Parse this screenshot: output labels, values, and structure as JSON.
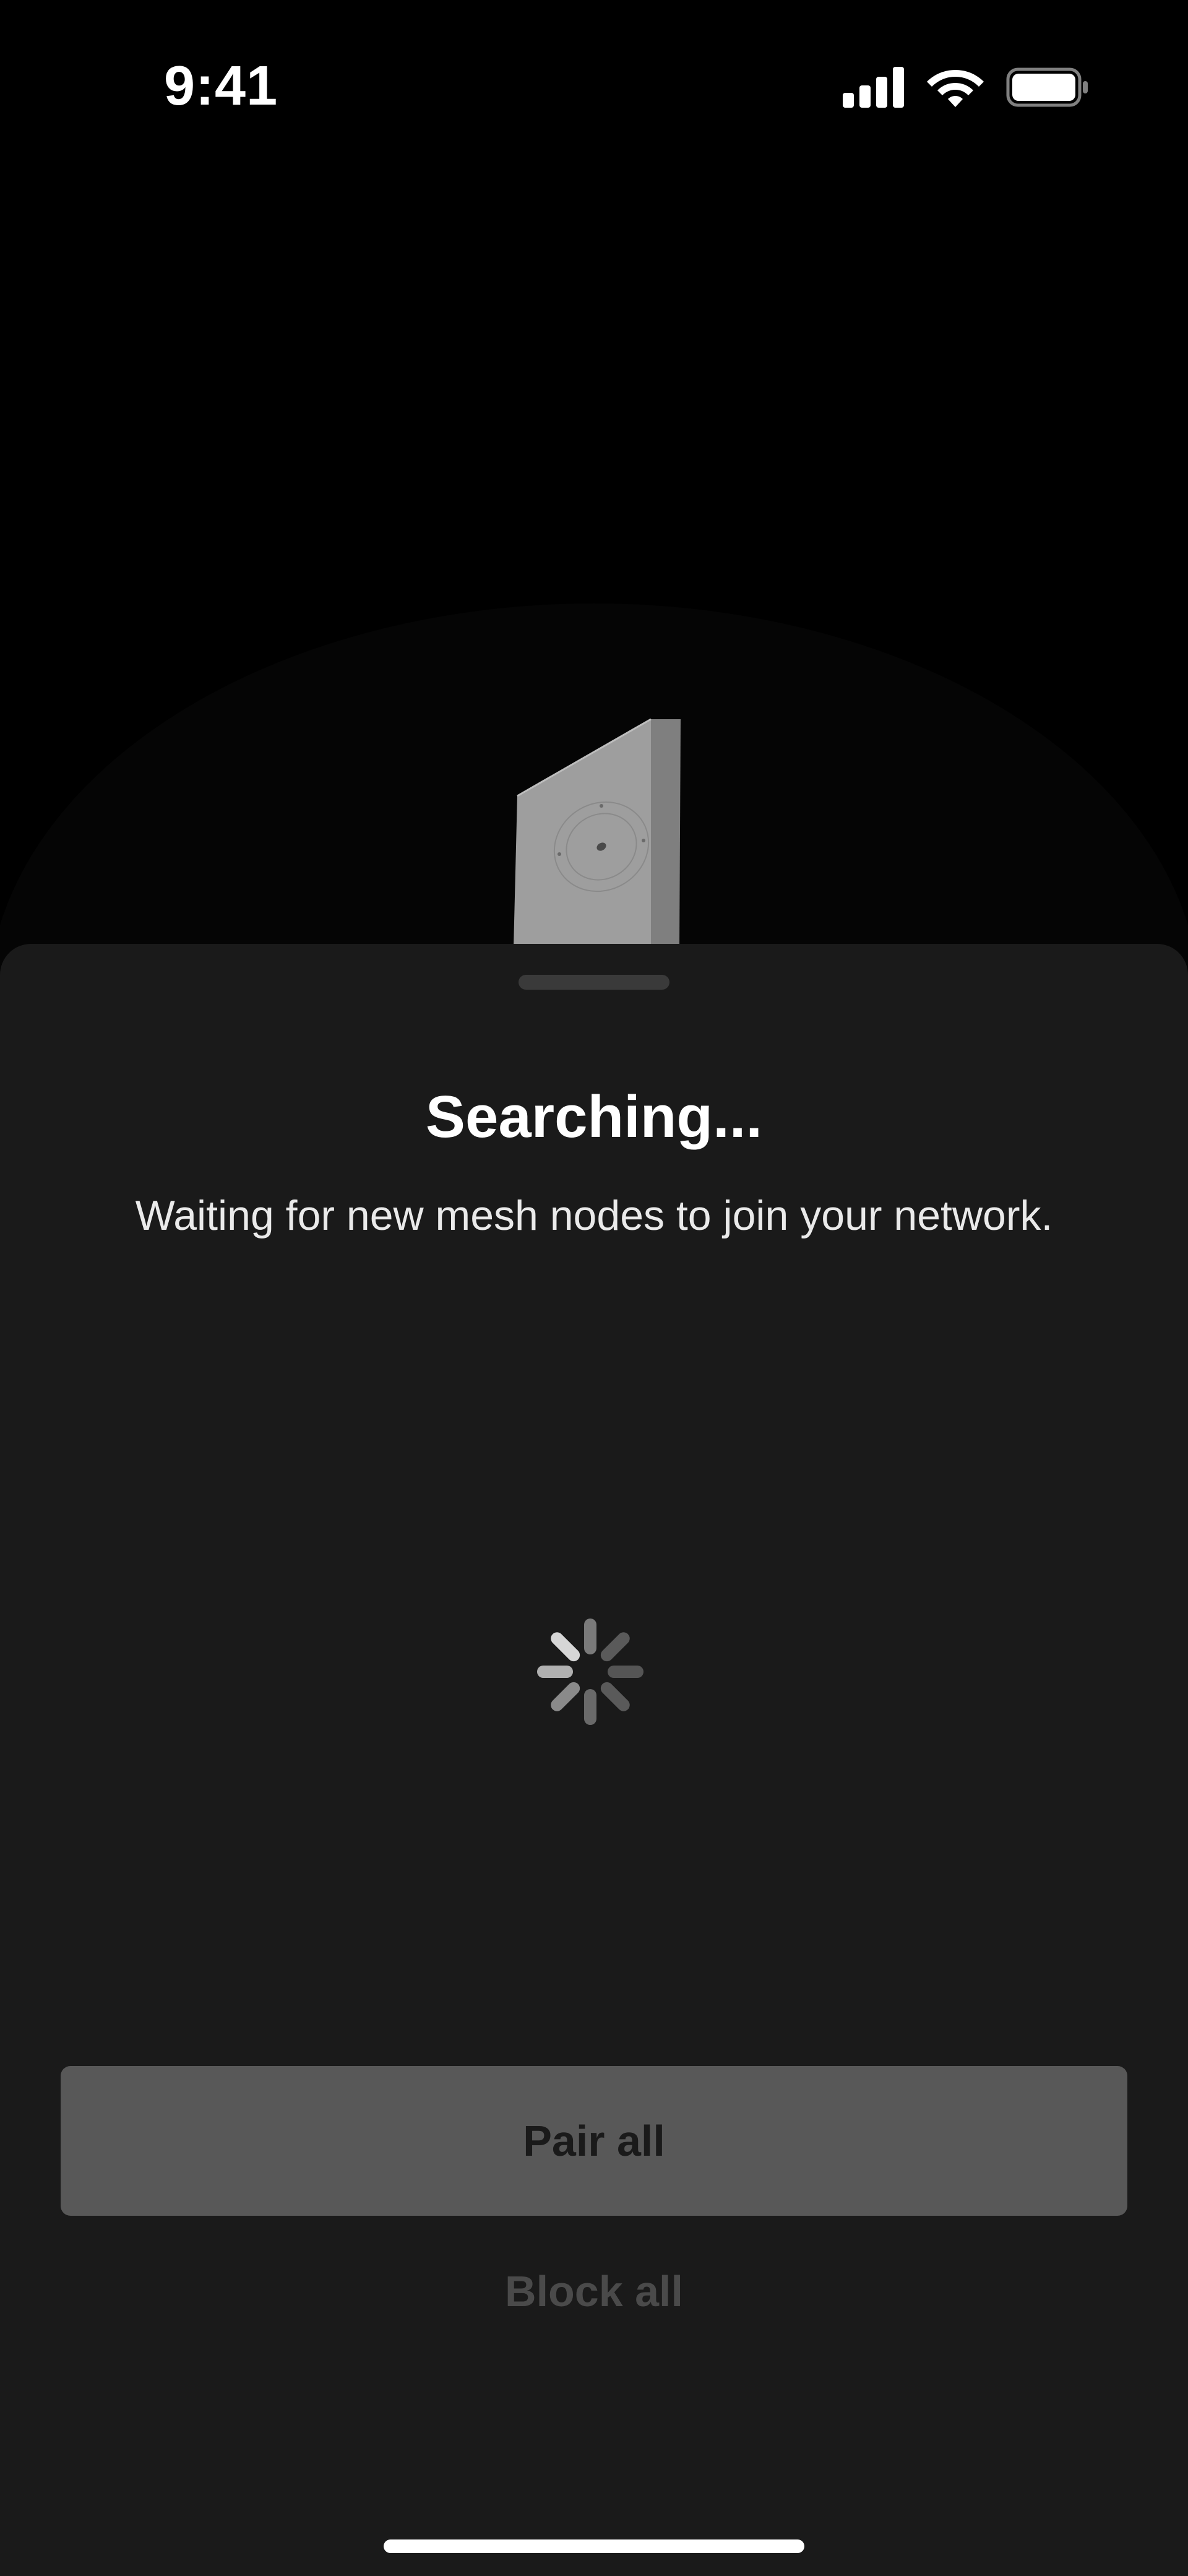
{
  "status_bar": {
    "time": "9:41",
    "icons": [
      "cellular-signal-icon",
      "wifi-icon",
      "battery-icon"
    ]
  },
  "hero": {
    "illustration": "mesh-node-device-icon"
  },
  "sheet": {
    "title": "Searching...",
    "subtitle": "Waiting for new mesh nodes to join your network.",
    "spinner": "loading-spinner-icon",
    "primary_button_label": "Pair all",
    "secondary_button_label": "Block all"
  },
  "colors": {
    "background": "#000000",
    "sheet_background": "#1a1a1a",
    "primary_button": "#585858",
    "disabled_text": "#4a4a4a"
  }
}
